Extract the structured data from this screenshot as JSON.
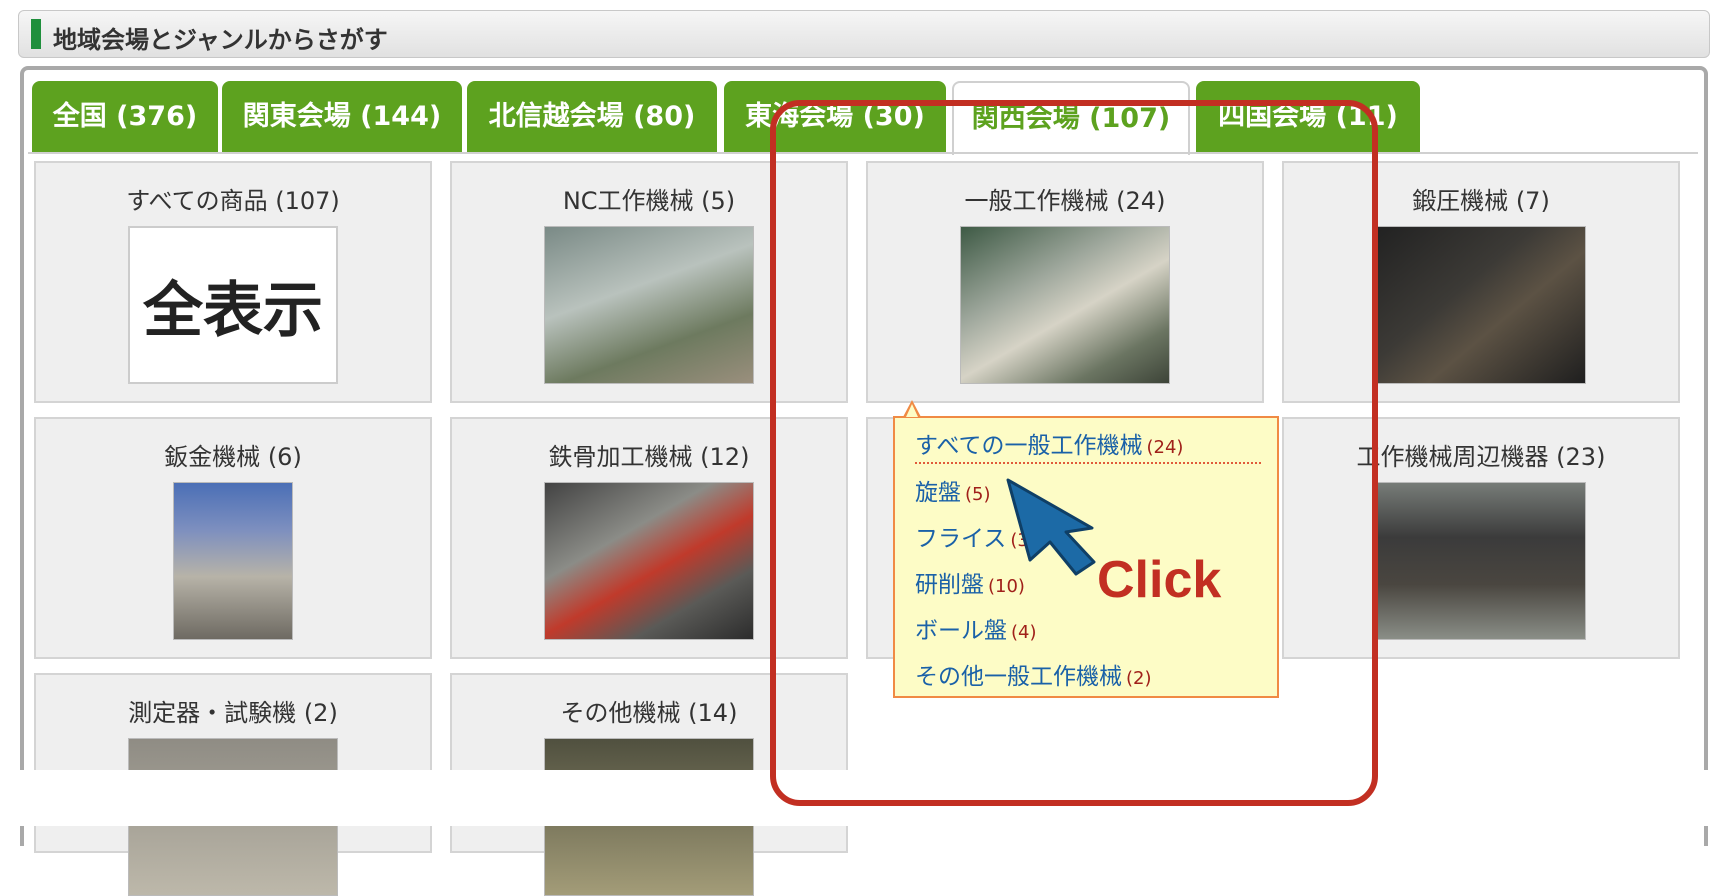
{
  "header": {
    "title": "地域会場とジャンルからさがす"
  },
  "tabs": [
    {
      "label": "全国 (376)"
    },
    {
      "label": "関東会場 (144)"
    },
    {
      "label": "北信越会場 (80)"
    },
    {
      "label": "東海会場 (30)"
    },
    {
      "label": "関西会場 (107)",
      "active": true
    },
    {
      "label": "四国会場 (11)"
    }
  ],
  "categories": [
    {
      "label": "すべての商品 (107)",
      "image_text": "全表示"
    },
    {
      "label": "NC工作機械 (5)"
    },
    {
      "label": "一般工作機械 (24)"
    },
    {
      "label": "鍛圧機械 (7)"
    },
    {
      "label": "鈑金機械 (6)"
    },
    {
      "label": "鉄骨加工機械 (12)"
    },
    {
      "label": "工作機械周辺機器 (23)"
    },
    {
      "label": "測定器・試験機 (2)"
    },
    {
      "label": "その他機械 (14)"
    }
  ],
  "popup": {
    "items": [
      {
        "label": "すべての一般工作機械",
        "count": "(24)"
      },
      {
        "label": "旋盤",
        "count": "(5)"
      },
      {
        "label": "フライス",
        "count": "(3)"
      },
      {
        "label": "研削盤",
        "count": "(10)"
      },
      {
        "label": "ボール盤",
        "count": "(4)"
      },
      {
        "label": "その他一般工作機械",
        "count": "(2)"
      }
    ]
  },
  "annotation": {
    "text": "Click",
    "color": "#c22f22"
  },
  "colors": {
    "tab_green": "#5da21f",
    "link_blue": "#1a61a8",
    "count_red": "#a0201a",
    "popup_bg": "#fdfcc6"
  }
}
